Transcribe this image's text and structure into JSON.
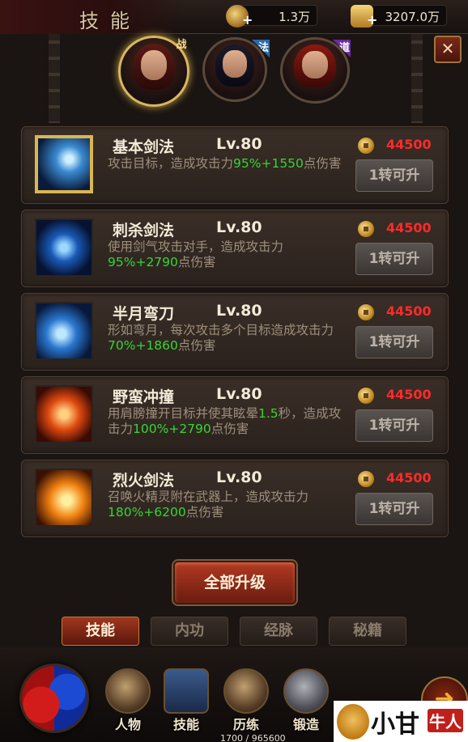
{
  "header": {
    "title": "技能",
    "currency1": {
      "icon": "key-coin-icon",
      "value": "1.3万"
    },
    "currency2": {
      "icon": "gold-ingot-icon",
      "value": "3207.0万"
    },
    "close_label": "✕"
  },
  "characters": [
    {
      "badge": "战",
      "selected": true
    },
    {
      "badge": "法",
      "selected": false
    },
    {
      "badge": "道",
      "selected": false
    }
  ],
  "skills": [
    {
      "name": "基本剑法",
      "level": "Lv.80",
      "desc_pre": "攻击目标，造成攻击力",
      "desc_hl": "95%+1550",
      "desc_post": "点伤害",
      "cost": "44500",
      "button": "1转可升",
      "icon": "sword-strike-icon",
      "selected": true
    },
    {
      "name": "刺杀剑法",
      "level": "Lv.80",
      "desc_pre": "使用剑气攻击对手，造成攻击力",
      "desc_hl": "95%+2790",
      "desc_post": "点伤害",
      "cost": "44500",
      "button": "1转可升",
      "icon": "thrust-slash-icon",
      "selected": false
    },
    {
      "name": "半月弯刀",
      "level": "Lv.80",
      "desc_pre": "形如弯月，每次攻击多个目标造成攻击力",
      "desc_hl": "70%+1860",
      "desc_post": "点伤害",
      "cost": "44500",
      "button": "1转可升",
      "icon": "crescent-blade-icon",
      "selected": false
    },
    {
      "name": "野蛮冲撞",
      "level": "Lv.80",
      "desc_pre": "用肩膀撞开目标并使其眩晕",
      "desc_hl": "1.5",
      "desc_mid": "秒，造成攻击力",
      "desc_hl2": "100%+2790",
      "desc_post": "点伤害",
      "cost": "44500",
      "button": "1转可升",
      "icon": "running-charge-icon",
      "selected": false
    },
    {
      "name": "烈火剑法",
      "level": "Lv.80",
      "desc_pre": "召唤火精灵附在武器上，造成攻击力",
      "desc_hl": "180%+6200",
      "desc_post": "点伤害",
      "cost": "44500",
      "button": "1转可升",
      "icon": "flame-sword-icon",
      "selected": false
    }
  ],
  "all_upgrade_label": "全部升级",
  "tabs": [
    {
      "label": "技能",
      "active": true
    },
    {
      "label": "内功",
      "active": false
    },
    {
      "label": "经脉",
      "active": false
    },
    {
      "label": "秘籍",
      "active": false
    }
  ],
  "nav": [
    {
      "label": "人物",
      "icon": "helmet-icon"
    },
    {
      "label": "技能",
      "icon": "spellbook-icon"
    },
    {
      "label": "历练",
      "icon": "armor-icon"
    },
    {
      "label": "锻造",
      "icon": "anvil-hammer-icon"
    }
  ],
  "exp_text": "1700 / 965600",
  "watermark": {
    "brand": "小甘",
    "tag": "牛人"
  },
  "colors": {
    "highlight": "#32d832",
    "cost": "#ff2a2a",
    "active_tab": "#a0361e",
    "selected_border": "#d9b650"
  }
}
